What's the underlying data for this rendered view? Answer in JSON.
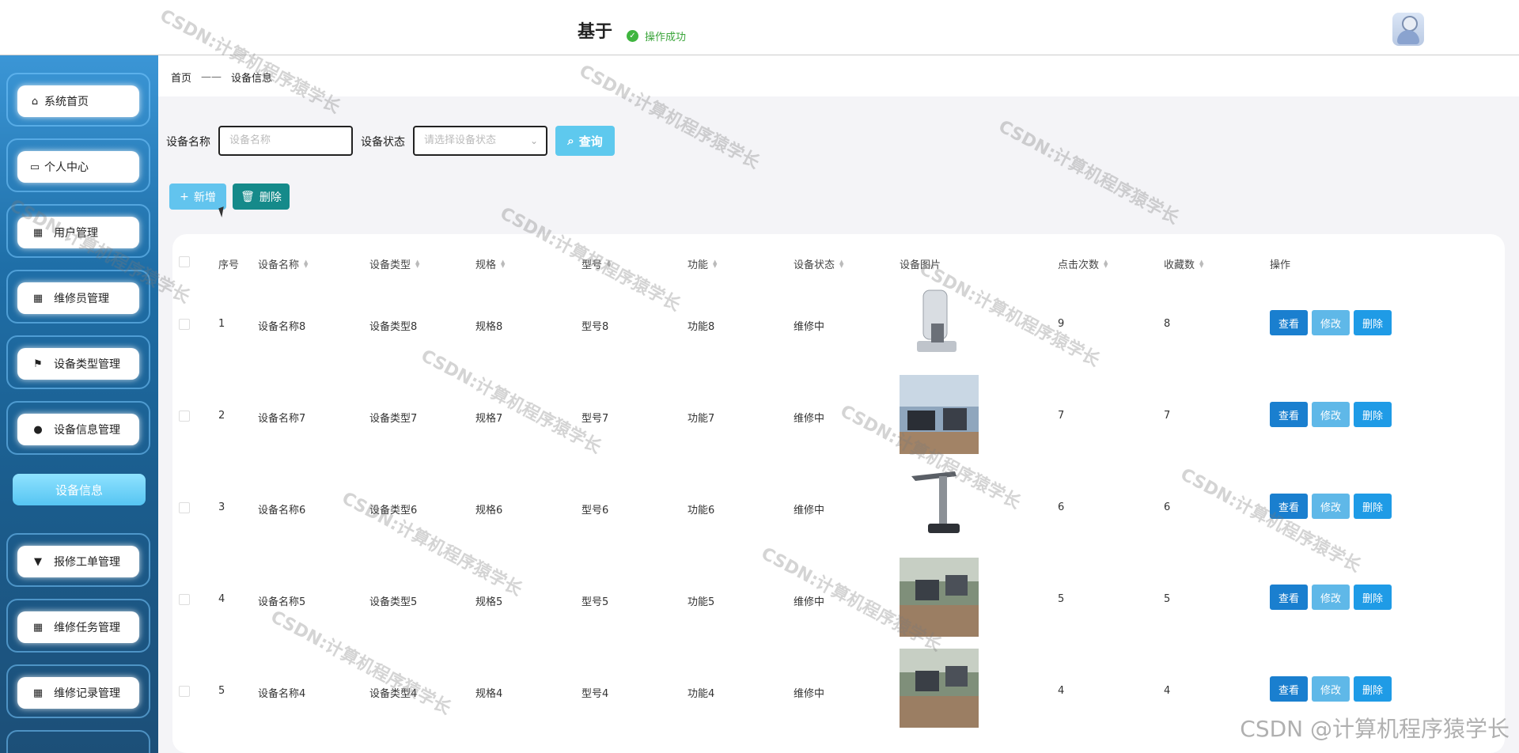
{
  "header": {
    "title": "基于",
    "toast": "操作成功"
  },
  "sidebar": {
    "items": [
      {
        "label": "系统首页",
        "icon": "home-icon"
      },
      {
        "label": "个人中心",
        "icon": "card-icon"
      },
      {
        "label": "用户管理",
        "icon": "grid-icon"
      },
      {
        "label": "维修员管理",
        "icon": "grid-icon"
      },
      {
        "label": "设备类型管理",
        "icon": "flag-icon"
      },
      {
        "label": "设备信息管理",
        "icon": "user-icon"
      },
      {
        "label": "报修工单管理",
        "icon": "brush-icon"
      },
      {
        "label": "维修任务管理",
        "icon": "grid-icon"
      },
      {
        "label": "维修记录管理",
        "icon": "grid-icon"
      }
    ],
    "active_sub": "设备信息"
  },
  "breadcrumb": {
    "home": "首页",
    "sep": "——",
    "current": "设备信息"
  },
  "search": {
    "name_label": "设备名称",
    "name_placeholder": "设备名称",
    "status_label": "设备状态",
    "status_placeholder": "请选择设备状态",
    "query": "查询"
  },
  "toolbar": {
    "add": "新增",
    "delete": "删除"
  },
  "table": {
    "headers": [
      "序号",
      "设备名称",
      "设备类型",
      "规格",
      "型号",
      "功能",
      "设备状态",
      "设备图片",
      "点击次数",
      "收藏数",
      "操作"
    ],
    "rows": [
      {
        "no": "1",
        "name": "设备名称8",
        "type": "设备类型8",
        "spec": "规格8",
        "model": "型号8",
        "func": "功能8",
        "status": "维修中",
        "clicks": "9",
        "favs": "8"
      },
      {
        "no": "2",
        "name": "设备名称7",
        "type": "设备类型7",
        "spec": "规格7",
        "model": "型号7",
        "func": "功能7",
        "status": "维修中",
        "clicks": "7",
        "favs": "7"
      },
      {
        "no": "3",
        "name": "设备名称6",
        "type": "设备类型6",
        "spec": "规格6",
        "model": "型号6",
        "func": "功能6",
        "status": "维修中",
        "clicks": "6",
        "favs": "6"
      },
      {
        "no": "4",
        "name": "设备名称5",
        "type": "设备类型5",
        "spec": "规格5",
        "model": "型号5",
        "func": "功能5",
        "status": "维修中",
        "clicks": "5",
        "favs": "5"
      },
      {
        "no": "5",
        "name": "设备名称4",
        "type": "设备类型4",
        "spec": "规格4",
        "model": "型号4",
        "func": "功能4",
        "status": "维修中",
        "clicks": "4",
        "favs": "4"
      }
    ],
    "actions": {
      "view": "查看",
      "edit": "修改",
      "delete": "删除"
    }
  },
  "watermark": {
    "text": "CSDN:计算机程序猿学长",
    "corner": "CSDN @计算机程序猿学长"
  }
}
